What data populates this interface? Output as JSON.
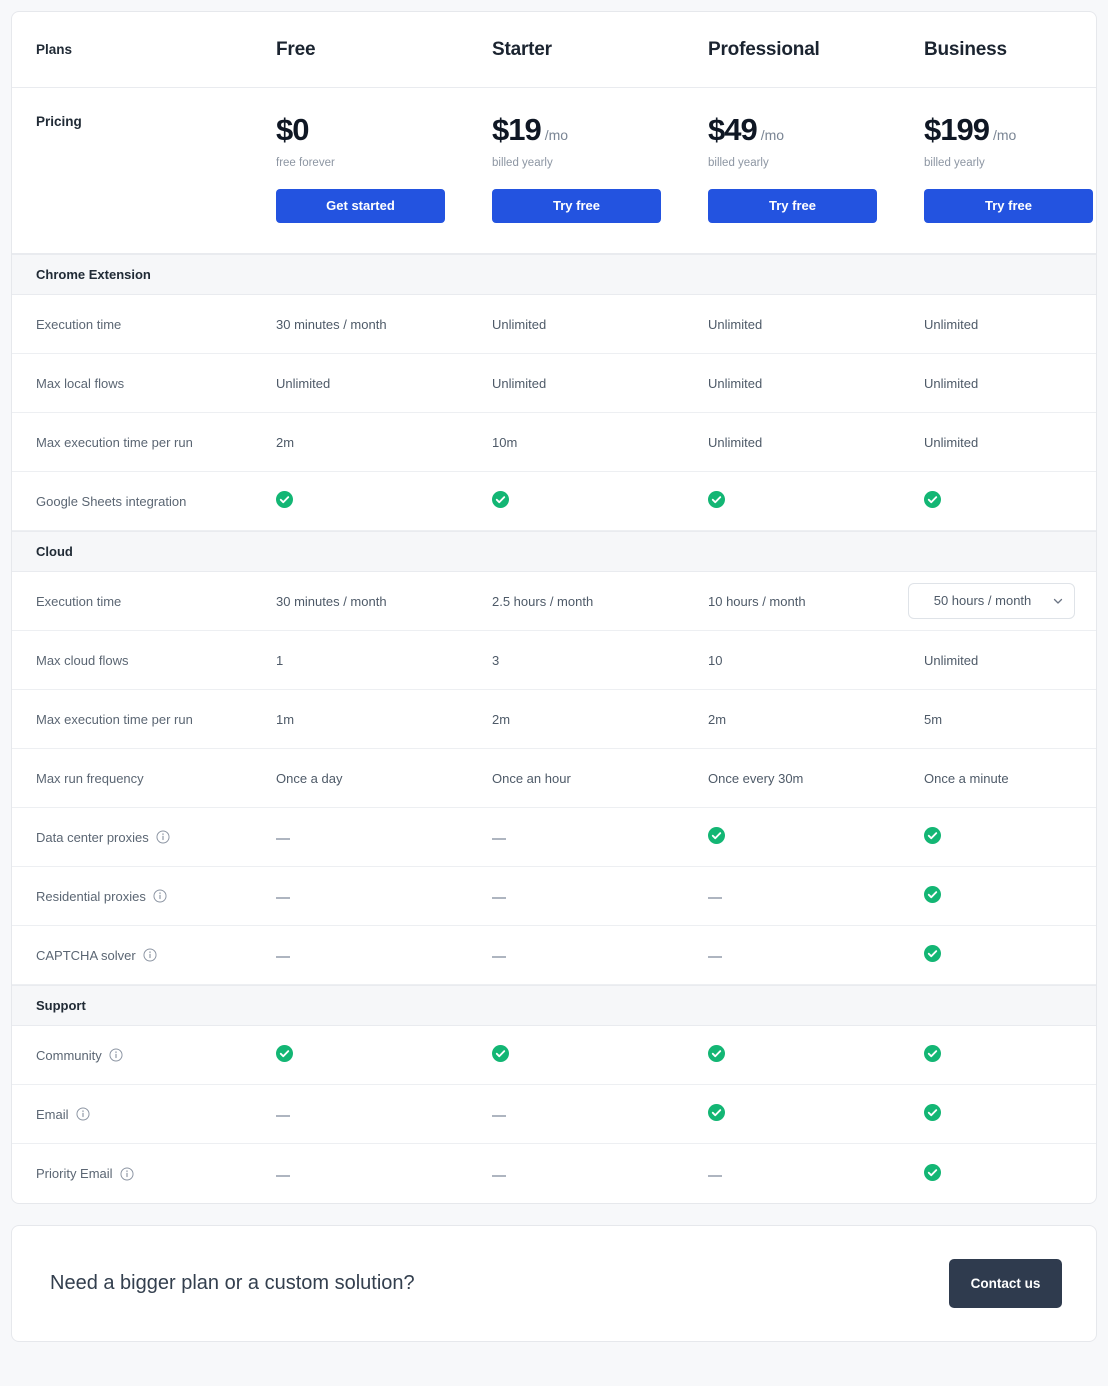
{
  "table": {
    "header": {
      "label": "Plans",
      "plans": [
        "Free",
        "Starter",
        "Professional",
        "Business"
      ]
    },
    "pricing": {
      "label": "Pricing",
      "plans": [
        {
          "amount": "$0",
          "per": "",
          "note": "free forever",
          "cta": "Get started"
        },
        {
          "amount": "$19",
          "per": "/mo",
          "note": "billed yearly",
          "cta": "Try free"
        },
        {
          "amount": "$49",
          "per": "/mo",
          "note": "billed yearly",
          "cta": "Try free"
        },
        {
          "amount": "$199",
          "per": "/mo",
          "note": "billed yearly",
          "cta": "Try free"
        }
      ]
    },
    "sections": [
      {
        "title": "Chrome Extension",
        "rows": [
          {
            "label": "Execution time",
            "info": false,
            "values": [
              {
                "type": "text",
                "text": "30 minutes / month"
              },
              {
                "type": "text",
                "text": "Unlimited"
              },
              {
                "type": "text",
                "text": "Unlimited"
              },
              {
                "type": "text",
                "text": "Unlimited"
              }
            ]
          },
          {
            "label": "Max local flows",
            "info": false,
            "values": [
              {
                "type": "text",
                "text": "Unlimited"
              },
              {
                "type": "text",
                "text": "Unlimited"
              },
              {
                "type": "text",
                "text": "Unlimited"
              },
              {
                "type": "text",
                "text": "Unlimited"
              }
            ]
          },
          {
            "label": "Max execution time per run",
            "info": false,
            "values": [
              {
                "type": "text",
                "text": "2m"
              },
              {
                "type": "text",
                "text": "10m"
              },
              {
                "type": "text",
                "text": "Unlimited"
              },
              {
                "type": "text",
                "text": "Unlimited"
              }
            ]
          },
          {
            "label": "Google Sheets integration",
            "info": false,
            "values": [
              {
                "type": "check"
              },
              {
                "type": "check"
              },
              {
                "type": "check"
              },
              {
                "type": "check"
              }
            ]
          }
        ]
      },
      {
        "title": "Cloud",
        "rows": [
          {
            "label": "Execution time",
            "info": false,
            "values": [
              {
                "type": "text",
                "text": "30 minutes / month"
              },
              {
                "type": "text",
                "text": "2.5 hours / month"
              },
              {
                "type": "text",
                "text": "10 hours / month"
              },
              {
                "type": "select",
                "text": "50 hours / month"
              }
            ]
          },
          {
            "label": "Max cloud flows",
            "info": false,
            "values": [
              {
                "type": "text",
                "text": "1"
              },
              {
                "type": "text",
                "text": "3"
              },
              {
                "type": "text",
                "text": "10"
              },
              {
                "type": "text",
                "text": "Unlimited"
              }
            ]
          },
          {
            "label": "Max execution time per run",
            "info": false,
            "values": [
              {
                "type": "text",
                "text": "1m"
              },
              {
                "type": "text",
                "text": "2m"
              },
              {
                "type": "text",
                "text": "2m"
              },
              {
                "type": "text",
                "text": "5m"
              }
            ]
          },
          {
            "label": "Max run frequency",
            "info": false,
            "values": [
              {
                "type": "text",
                "text": "Once a day"
              },
              {
                "type": "text",
                "text": "Once an hour"
              },
              {
                "type": "text",
                "text": "Once every 30m"
              },
              {
                "type": "text",
                "text": "Once a minute"
              }
            ]
          },
          {
            "label": "Data center proxies",
            "info": true,
            "values": [
              {
                "type": "dash"
              },
              {
                "type": "dash"
              },
              {
                "type": "check"
              },
              {
                "type": "check"
              }
            ]
          },
          {
            "label": "Residential proxies",
            "info": true,
            "values": [
              {
                "type": "dash"
              },
              {
                "type": "dash"
              },
              {
                "type": "dash"
              },
              {
                "type": "check"
              }
            ]
          },
          {
            "label": "CAPTCHA solver",
            "info": true,
            "values": [
              {
                "type": "dash"
              },
              {
                "type": "dash"
              },
              {
                "type": "dash"
              },
              {
                "type": "check"
              }
            ]
          }
        ]
      },
      {
        "title": "Support",
        "rows": [
          {
            "label": "Community",
            "info": true,
            "values": [
              {
                "type": "check"
              },
              {
                "type": "check"
              },
              {
                "type": "check"
              },
              {
                "type": "check"
              }
            ]
          },
          {
            "label": "Email",
            "info": true,
            "values": [
              {
                "type": "dash"
              },
              {
                "type": "dash"
              },
              {
                "type": "check"
              },
              {
                "type": "check"
              }
            ]
          },
          {
            "label": "Priority Email",
            "info": true,
            "values": [
              {
                "type": "dash"
              },
              {
                "type": "dash"
              },
              {
                "type": "dash"
              },
              {
                "type": "check"
              }
            ]
          }
        ]
      }
    ]
  },
  "footer": {
    "title": "Need a bigger plan or a custom solution?",
    "contact_label": "Contact us"
  },
  "colors": {
    "primary": "#2353e0",
    "check_green": "#13b674",
    "dark_button": "#2f3b4e",
    "section_bg": "#f6f7f9",
    "page_bg": "#f7f8fa"
  },
  "icons": {
    "info": "info-icon",
    "check": "check-circle-icon",
    "dash": "dash-icon",
    "chevron": "chevron-down-icon"
  }
}
